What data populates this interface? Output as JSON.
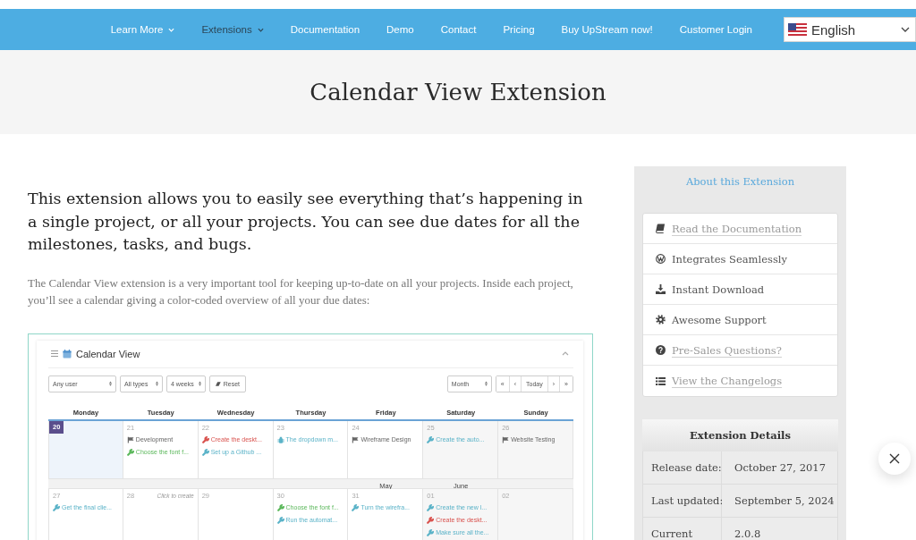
{
  "nav": {
    "items": [
      {
        "label": "Learn More",
        "dropdown": true,
        "selected": false
      },
      {
        "label": "Extensions",
        "dropdown": true,
        "selected": true
      },
      {
        "label": "Documentation",
        "dropdown": false,
        "selected": false
      },
      {
        "label": "Demo",
        "dropdown": false,
        "selected": false
      },
      {
        "label": "Contact",
        "dropdown": false,
        "selected": false
      },
      {
        "label": "Pricing",
        "dropdown": false,
        "selected": false
      },
      {
        "label": "Buy UpStream now!",
        "dropdown": false,
        "selected": false
      },
      {
        "label": "Customer Login",
        "dropdown": false,
        "selected": false
      }
    ],
    "language": {
      "label": "English"
    }
  },
  "page_title": "Calendar View Extension",
  "intro": "This extension allows you to easily see everything that’s happening in a single project, or all your projects. You can see due dates for all the milestones, tasks, and bugs.",
  "description": "The Calendar View extension is a very important tool for keeping up-to-date on all your projects. Inside each project, you’ll see a calendar giving a color-coded overview of all your due dates:",
  "screenshot": {
    "title": "Calendar View",
    "filters": [
      "Any user",
      "All types",
      "4 weeks"
    ],
    "reset_button": "Reset",
    "view_select": "Month",
    "pager": [
      "«",
      "‹",
      "Today",
      "›",
      "»"
    ],
    "weekdays": [
      "Monday",
      "Tuesday",
      "Wednesday",
      "Thursday",
      "Friday",
      "Saturday",
      "Sunday"
    ],
    "weeks": [
      {
        "days": [
          {
            "number": "20",
            "today": true
          },
          {
            "number": "21",
            "today": false,
            "events": [
              {
                "kind": "milestone",
                "title": "Development",
                "color": "#666666"
              },
              {
                "kind": "task",
                "title": "Choose the font f...",
                "color": "#5cb85c"
              }
            ]
          },
          {
            "number": "22",
            "today": false,
            "events": [
              {
                "kind": "task",
                "title": "Create the deskt...",
                "color": "#d9534f"
              },
              {
                "kind": "task",
                "title": "Set up a Github ...",
                "color": "#5bb3c8"
              }
            ]
          },
          {
            "number": "23",
            "today": false,
            "events": [
              {
                "kind": "bug",
                "title": "The dropdown m...",
                "color": "#5bb3c8"
              }
            ]
          },
          {
            "number": "24",
            "today": false,
            "events": [
              {
                "kind": "milestone",
                "title": "Wireframe Design",
                "color": "#666666"
              }
            ]
          },
          {
            "number": "25",
            "today": false,
            "events": [
              {
                "kind": "task",
                "title": "Create the auto...",
                "color": "#5bb3c8"
              }
            ]
          },
          {
            "number": "26",
            "today": false,
            "events": [
              {
                "kind": "milestone",
                "title": "Website Testing",
                "color": "#666666"
              }
            ]
          }
        ]
      },
      {
        "days": [
          {
            "number": "27",
            "today": false,
            "events": [
              {
                "kind": "task",
                "title": "Get the final clie...",
                "color": "#5bb3c8"
              }
            ]
          },
          {
            "number": "28",
            "today": false,
            "hint": "Click to create"
          },
          {
            "number": "29",
            "today": false
          },
          {
            "number": "30",
            "today": false,
            "events": [
              {
                "kind": "task",
                "title": "Choose the font f...",
                "color": "#5cb85c"
              },
              {
                "kind": "task",
                "title": "Run the automat...",
                "color": "#5bb3c8"
              }
            ]
          },
          {
            "number": "31",
            "today": false,
            "month_label": "May",
            "events": [
              {
                "kind": "task",
                "title": "Turn the wirefra...",
                "color": "#5bb3c8"
              }
            ]
          },
          {
            "number": "01",
            "today": false,
            "month_label": "June",
            "events": [
              {
                "kind": "task",
                "title": "Create the new l...",
                "color": "#5bb3c8"
              },
              {
                "kind": "task",
                "title": "Create the deskt...",
                "color": "#d9534f"
              },
              {
                "kind": "task",
                "title": "Make sure all the...",
                "color": "#5bb3c8"
              }
            ]
          },
          {
            "number": "02",
            "today": false
          }
        ]
      }
    ]
  },
  "sidebar": {
    "title": "About this Extension",
    "items": [
      {
        "label": "Read the Documentation",
        "link": true
      },
      {
        "label": "Integrates Seamlessly",
        "link": false
      },
      {
        "label": "Instant Download",
        "link": false
      },
      {
        "label": "Awesome Support",
        "link": false
      },
      {
        "label": "Pre-Sales Questions?",
        "link": true
      },
      {
        "label": "View the Changelogs",
        "link": true
      }
    ],
    "details": {
      "title": "Extension Details",
      "rows": [
        {
          "label": "Release date:",
          "value": "October 27, 2017"
        },
        {
          "label": "Last updated:",
          "value": "September 5, 2024"
        },
        {
          "label": "Current",
          "value": "2.0.8"
        }
      ]
    }
  }
}
